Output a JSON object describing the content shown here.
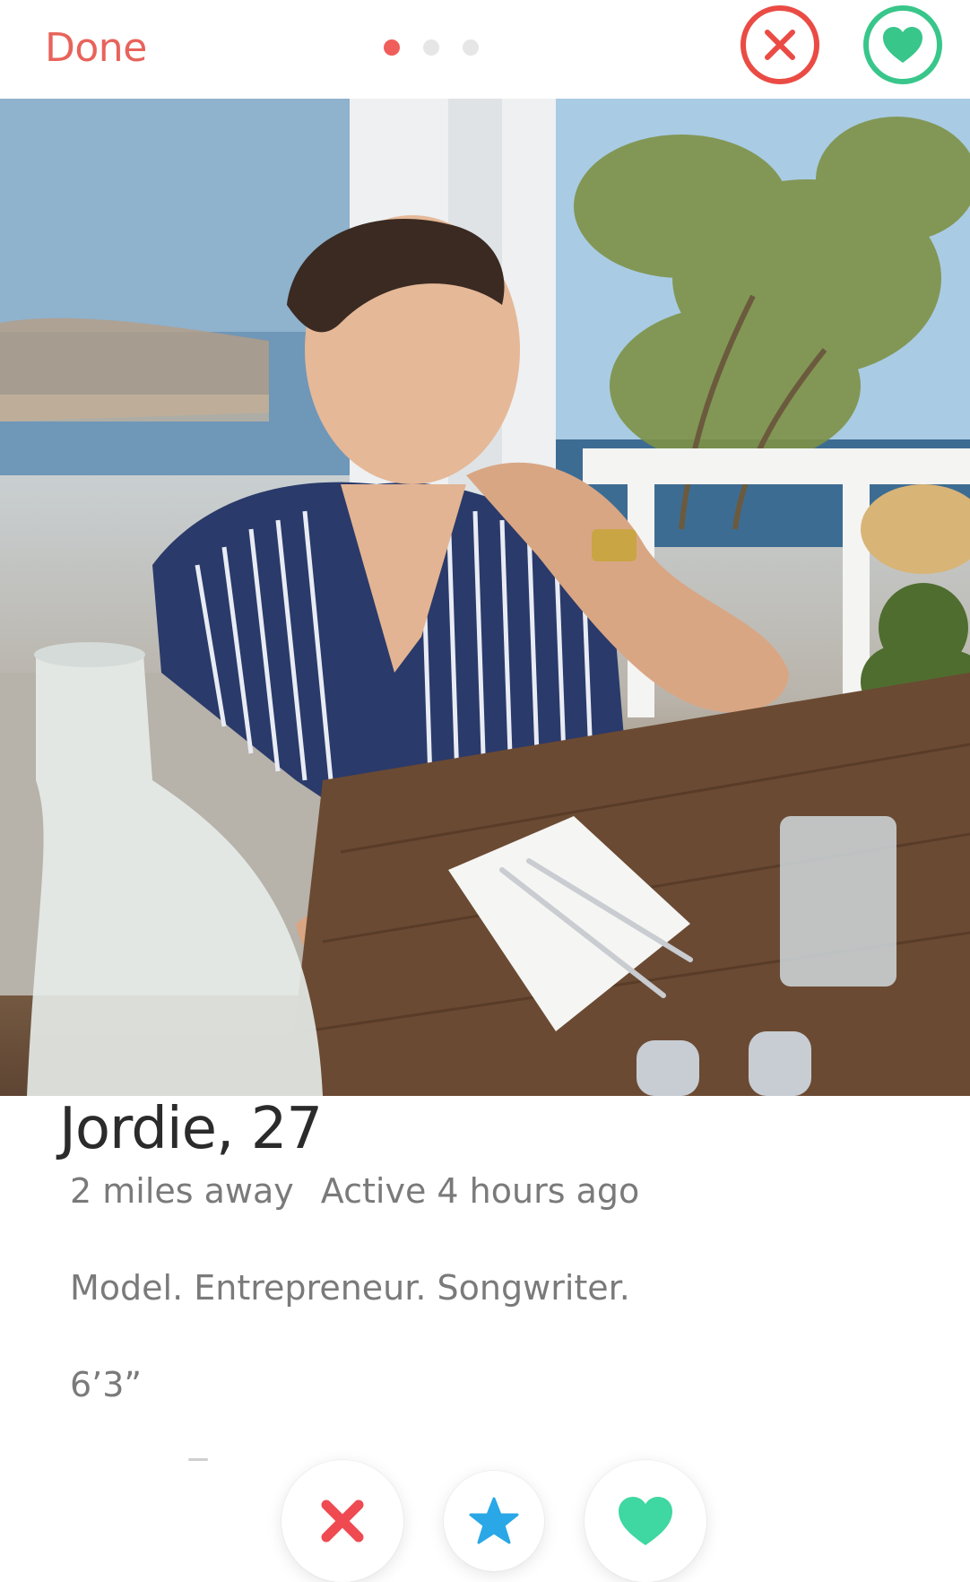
{
  "topbar": {
    "done_label": "Done",
    "photo_indicator": {
      "count": 3,
      "active_index": 0
    },
    "nope_icon": "close-circle-icon",
    "like_icon": "heart-circle-icon",
    "colors": {
      "accent": "#ef5e5b",
      "nope": "#ea4b44",
      "like": "#38c68a"
    }
  },
  "photo": {
    "subject": "profile-photo"
  },
  "profile": {
    "name_age": "Jordie, 27",
    "distance": "2 miles away",
    "activity": "Active 4 hours ago",
    "bio": "Model. Entrepreneur. Songwriter.",
    "height": "6’3”"
  },
  "actions": {
    "nope_icon": "x-icon",
    "super_like_icon": "star-icon",
    "like_icon": "heart-icon",
    "colors": {
      "nope": "#ef4a52",
      "super_like": "#2aa7e6",
      "like": "#3fd7a2"
    }
  }
}
